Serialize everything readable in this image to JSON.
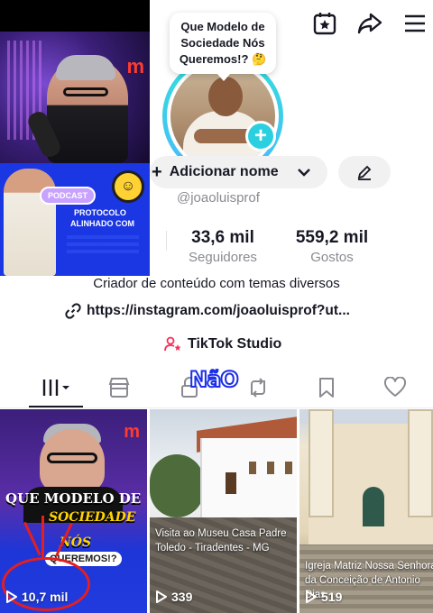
{
  "bubble": {
    "text": "Que Modelo de Sociedade Nós Queremos!? 🤔"
  },
  "profile": {
    "name_button": "Adicionar nome",
    "handle": "@joaoluisprof",
    "stats": [
      {
        "value": "33,6 mil",
        "label": "Seguidores"
      },
      {
        "value": "559,2 mil",
        "label": "Gostos"
      }
    ],
    "bio": "Criador de conteúdo com temas diversos",
    "link": "https://instagram.com/joaoluisprof?ut...",
    "studio": "TikTok Studio"
  },
  "overlay": {
    "nao": "NãO",
    "podcast_pill": "PODCAST",
    "podcast_line1": "PROTOCOLO",
    "podcast_line2": "ALINHADO COM",
    "logo": "m"
  },
  "tabs": [
    {
      "icon": "grid-icon",
      "active": true
    },
    {
      "icon": "shop-icon",
      "active": false
    },
    {
      "icon": "lock-icon",
      "active": false
    },
    {
      "icon": "repost-icon",
      "active": false
    },
    {
      "icon": "bookmark-icon",
      "active": false
    },
    {
      "icon": "heart-icon",
      "active": false
    }
  ],
  "videos": [
    {
      "views": "10,7 mil",
      "headline1": "QUE MODELO DE",
      "headline2": "SOCIEDADE",
      "headline3": "NÓS",
      "headline4": "QUEREMOS!?"
    },
    {
      "views": "339",
      "caption": "Visita ao Museu Casa Padre Toledo - Tiradentes - MG"
    },
    {
      "views": "519",
      "caption": "Igreja Matriz Nossa Senhora da Conceição de Antonio Dias"
    }
  ],
  "colors": {
    "accent_ring": "#2ee6d6",
    "plus": "#2bd0e0",
    "annotation_red": "#e41f1f"
  }
}
